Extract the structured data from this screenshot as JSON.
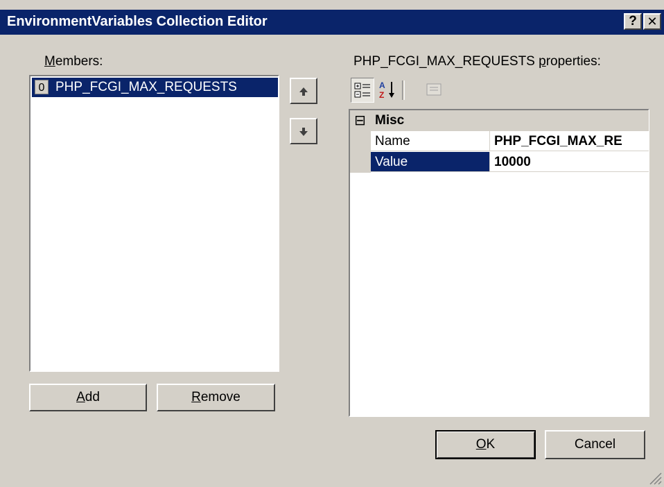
{
  "window": {
    "title": "EnvironmentVariables Collection Editor",
    "help_label": "?",
    "close_label": "✕"
  },
  "members": {
    "label_accel": "M",
    "label_rest": "embers:",
    "items": [
      {
        "index": "0",
        "name": "PHP_FCGI_MAX_REQUESTS",
        "selected": true
      }
    ],
    "move_up_icon": "arrow-up-icon",
    "move_down_icon": "arrow-down-icon"
  },
  "buttons": {
    "add_accel": "A",
    "add_rest": "dd",
    "remove_accel": "R",
    "remove_rest": "emove",
    "ok_accel": "O",
    "ok_rest": "K",
    "cancel": "Cancel"
  },
  "properties": {
    "label_prefix": "PHP_FCGI_MAX_REQUESTS ",
    "label_accel": "p",
    "label_rest": "roperties:",
    "toolbar": {
      "categorized_icon": "categorized-icon",
      "alphabetical_icon": "sort-az-icon",
      "property_pages_icon": "property-pages-icon"
    },
    "category": {
      "toggle": "⊟",
      "name": "Misc"
    },
    "rows": [
      {
        "name": "Name",
        "value": "PHP_FCGI_MAX_RE"
      },
      {
        "name": "Value",
        "value": "10000"
      }
    ]
  },
  "colors": {
    "title_bar": "#0a246a",
    "dialog_face": "#d4d0c8",
    "selection": "#0a246a"
  }
}
